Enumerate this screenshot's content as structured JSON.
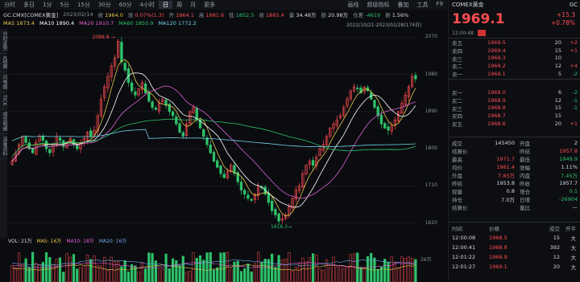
{
  "tabs": [
    "分时",
    "多日",
    "1分",
    "5分",
    "15分",
    "30分",
    "60分",
    "4小时",
    "日",
    "周",
    "月",
    "更多"
  ],
  "active_tab": "日",
  "right_tabs": [
    "画线",
    "超级指标",
    "叠加",
    "工具",
    "F9"
  ],
  "info": {
    "symbol": "GC.CMX[COMEX黄金]",
    "date": "2023/02/14",
    "items": [
      {
        "k": "收",
        "v": "1964.0",
        "color": "#e6c84b"
      },
      {
        "k": "涨",
        "v": "0.07%(1.3)",
        "color": "#ff4d4f"
      },
      {
        "k": "开",
        "v": "1864.1",
        "color": "#ff4d4f"
      },
      {
        "k": "高",
        "v": "1881.6",
        "color": "#ff4d4f"
      },
      {
        "k": "低",
        "v": "1852.5",
        "color": "#2ec26a"
      },
      {
        "k": "收",
        "v": "1865.4",
        "color": "#ff4d4f"
      },
      {
        "k": "量",
        "v": "34.48万",
        "color": "#d6d9df"
      },
      {
        "k": "额",
        "v": "20.98万",
        "color": "#d6d9df"
      },
      {
        "k": "仓差",
        "v": "-4619",
        "color": "#2ec26a"
      },
      {
        "k": "振",
        "v": "1.56%",
        "color": "#d6d9df"
      }
    ]
  },
  "ma": [
    {
      "k": "MA5",
      "v": "1873.4",
      "color": "#e6c84b"
    },
    {
      "k": "MA10",
      "v": "1890.4",
      "color": "#ffffff"
    },
    {
      "k": "MA20",
      "v": "1910.7",
      "color": "#e060d0"
    },
    {
      "k": "MA60",
      "v": "1850.9",
      "color": "#2ec26a"
    },
    {
      "k": "MA120",
      "v": "1772.2",
      "color": "#6fd3e8"
    }
  ],
  "range_label": "2022/10/21-2023/02/28(174日)",
  "left_strip": [
    "分时走势",
    "K线图",
    "闪电图",
    "TICK",
    "成交明细",
    "深度资料"
  ],
  "y_labels": [
    "2070",
    "1980",
    "1890",
    "1800",
    "1710",
    "1620"
  ],
  "annotations": {
    "high": "2088.8",
    "low": "1618.3"
  },
  "vol_bar": [
    {
      "k": "VOL",
      "v": "21万",
      "color": "#d6d9df"
    },
    {
      "k": "MA5",
      "v": "16万",
      "color": "#e6c84b"
    },
    {
      "k": "MA10",
      "v": "18万",
      "color": "#e060d0"
    },
    {
      "k": "MA20",
      "v": "16万",
      "color": "#6fa8e8"
    }
  ],
  "vol_ylabel": "26万",
  "right_panel": {
    "name": "COMEX黄金",
    "code": "GC",
    "price": "1969.1",
    "change": "+15.3",
    "change_pct": "+0.78%",
    "time": "12:00:48",
    "asks": [
      {
        "label": "卖五",
        "price": "1969.5",
        "vol": "20",
        "chg": "+2"
      },
      {
        "label": "卖四",
        "price": "1969.4",
        "vol": "15",
        "chg": "+1"
      },
      {
        "label": "卖三",
        "price": "1969.3",
        "vol": "10",
        "chg": ""
      },
      {
        "label": "卖二",
        "price": "1969.2",
        "vol": "12",
        "chg": "+4"
      },
      {
        "label": "卖一",
        "price": "1969.1",
        "vol": "5",
        "chg": "-2"
      }
    ],
    "bids": [
      {
        "label": "买一",
        "price": "1969.0",
        "vol": "6",
        "chg": "-2"
      },
      {
        "label": "买二",
        "price": "1968.9",
        "vol": "12",
        "chg": "-1"
      },
      {
        "label": "买三",
        "price": "1968.8",
        "vol": "15",
        "chg": "-1"
      },
      {
        "label": "买四",
        "price": "1968.7",
        "vol": "15",
        "chg": ""
      },
      {
        "label": "买五",
        "price": "1968.6",
        "vol": "20",
        "chg": "+1"
      }
    ],
    "stats": [
      {
        "k": "成交",
        "v": "145450",
        "vc": "#d6d9df",
        "k2": "开盘",
        "v2": "2",
        "v2c": "#d6d9df"
      },
      {
        "k": "结算价",
        "v": "",
        "vc": "#d6d9df",
        "k2": "昨结",
        "v2": "1957.8",
        "v2c": "#ff4d4f"
      },
      {
        "k": "最高",
        "v": "1971.7",
        "vc": "#ff4d4f",
        "k2": "最低",
        "v2": "1949.9",
        "v2c": "#2ec26a"
      },
      {
        "k": "均价",
        "v": "1961.4",
        "vc": "#ff4d4f",
        "k2": "涨幅",
        "v2": "1.11%",
        "v2c": "#d6d9df"
      },
      {
        "k": "外盘",
        "v": "7.85万",
        "vc": "#ff4d4f",
        "k2": "内盘",
        "v2": "7.45万",
        "v2c": "#2ec26a"
      },
      {
        "k": "昨结",
        "v": "1953.8",
        "vc": "#d6d9df",
        "k2": "昨收",
        "v2": "1957.7",
        "v2c": "#d6d9df"
      },
      {
        "k": "现量",
        "v": "0.8",
        "vc": "#d6d9df",
        "k2": "增仓",
        "v2": "0.1",
        "v2c": "#2ec26a"
      },
      {
        "k": "持仓",
        "v": "7.0万",
        "vc": "#d6d9df",
        "k2": "日增",
        "v2": "-26904",
        "v2c": "#2ec26a"
      },
      {
        "k": "结算价",
        "v": "",
        "vc": "#d6d9df",
        "k2": "量比",
        "v2": "—",
        "v2c": "#d6d9df"
      }
    ],
    "trades_head": [
      "时间",
      "价格",
      "成交",
      "开平"
    ],
    "trades": [
      {
        "time": "12:00:08",
        "price": "1968.5",
        "vol": "15",
        "flag": "大"
      },
      {
        "time": "12:00:41",
        "price": "1968.8",
        "vol": "392",
        "flag": "大"
      },
      {
        "time": "12:01:22",
        "price": "1968.9",
        "vol": "12",
        "flag": "大"
      },
      {
        "time": "12:01:27",
        "price": "1969.1",
        "vol": "20",
        "flag": "大"
      }
    ]
  },
  "chart_data": {
    "type": "candlestick",
    "ylim": [
      1600,
      2090
    ],
    "candles_count": 88,
    "closes": [
      1770,
      1790,
      1810,
      1830,
      1815,
      1800,
      1790,
      1815,
      1830,
      1820,
      1800,
      1790,
      1810,
      1830,
      1820,
      1805,
      1815,
      1825,
      1810,
      1800,
      1815,
      1825,
      1840,
      1830,
      1845,
      1880,
      1920,
      1950,
      1975,
      2000,
      2020,
      2060,
      2010,
      1990,
      1960,
      1940,
      1930,
      1945,
      1960,
      1935,
      1915,
      1900,
      1895,
      1910,
      1920,
      1905,
      1890,
      1880,
      1860,
      1840,
      1830,
      1860,
      1890,
      1900,
      1870,
      1850,
      1830,
      1810,
      1790,
      1770,
      1755,
      1740,
      1730,
      1745,
      1760,
      1740,
      1720,
      1700,
      1690,
      1680,
      1675,
      1690,
      1710,
      1705,
      1690,
      1670,
      1650,
      1640,
      1625,
      1630,
      1640,
      1660,
      1680,
      1700,
      1710,
      1740,
      1760,
      1770,
      1760,
      1780,
      1800,
      1810,
      1830,
      1850,
      1860,
      1870,
      1880,
      1900,
      1920,
      1940,
      1950,
      1945,
      1935,
      1950,
      1940,
      1920,
      1900,
      1880,
      1860,
      1850,
      1845,
      1855,
      1870,
      1890,
      1910,
      1930,
      1950,
      1975,
      1969
    ]
  }
}
